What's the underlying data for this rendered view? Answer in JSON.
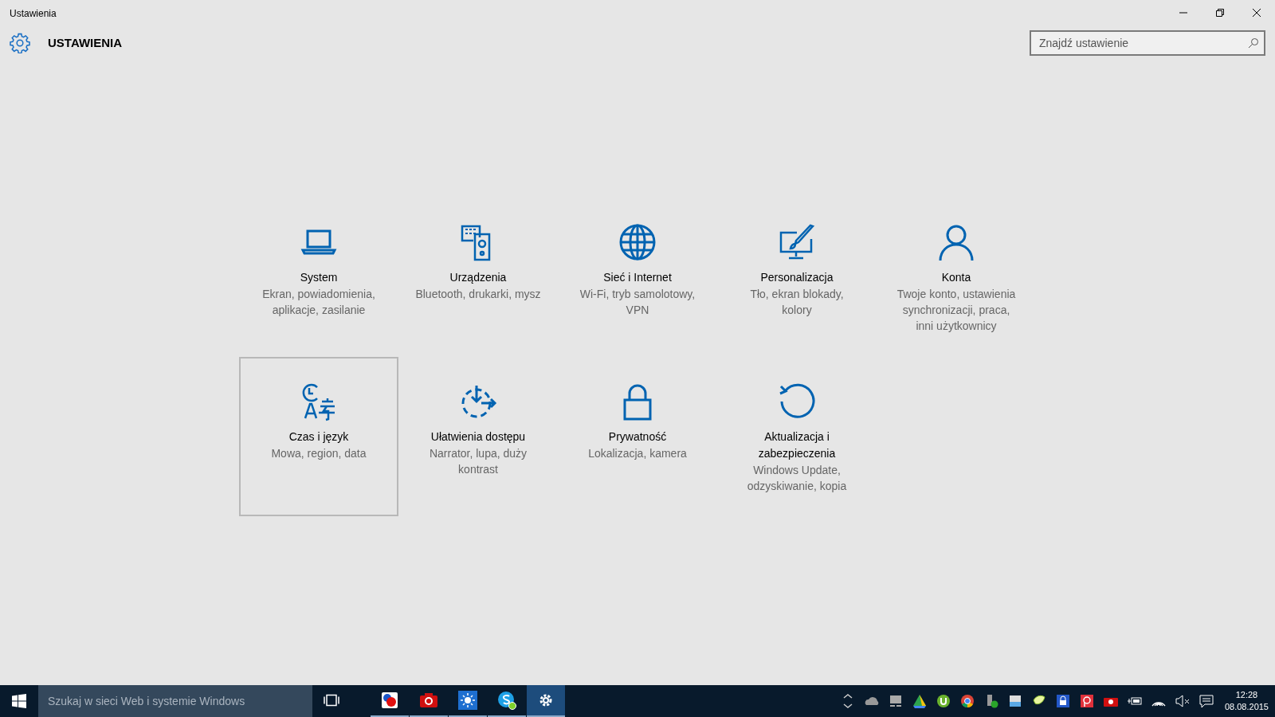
{
  "window": {
    "title": "Ustawienia"
  },
  "header": {
    "title": "USTAWIENIA",
    "search": {
      "placeholder": "Znajdź ustawienie"
    }
  },
  "tiles": [
    {
      "title": "System",
      "subtitle": "Ekran, powiadomienia, aplikacje, zasilanie",
      "selected": false
    },
    {
      "title": "Urządzenia",
      "subtitle": "Bluetooth, drukarki, mysz",
      "selected": false
    },
    {
      "title": "Sieć i Internet",
      "subtitle": "Wi-Fi, tryb samolotowy, VPN",
      "selected": false
    },
    {
      "title": "Personalizacja",
      "subtitle": "Tło, ekran blokady, kolory",
      "selected": false
    },
    {
      "title": "Konta",
      "subtitle": "Twoje konto, ustawienia synchronizacji, praca, inni użytkownicy",
      "selected": false
    },
    {
      "title": "Czas i język",
      "subtitle": "Mowa, region, data",
      "selected": true
    },
    {
      "title": "Ułatwienia dostępu",
      "subtitle": "Narrator, lupa, duży kontrast",
      "selected": false
    },
    {
      "title": "Prywatność",
      "subtitle": "Lokalizacja, kamera",
      "selected": false
    },
    {
      "title": "Aktualizacja i zabezpieczenia",
      "subtitle": "Windows Update, odzyskiwanie, kopia",
      "selected": false
    }
  ],
  "taskbar": {
    "search": {
      "placeholder": "Szukaj w sieci Web i systemie Windows"
    },
    "apps": [
      {
        "running": true,
        "active": false
      },
      {
        "running": true,
        "active": false
      },
      {
        "running": true,
        "active": false
      },
      {
        "running": true,
        "active": false
      },
      {
        "running": true,
        "active": true
      }
    ],
    "clock": {
      "time": "12:28",
      "date": "08.08.2015"
    }
  }
}
